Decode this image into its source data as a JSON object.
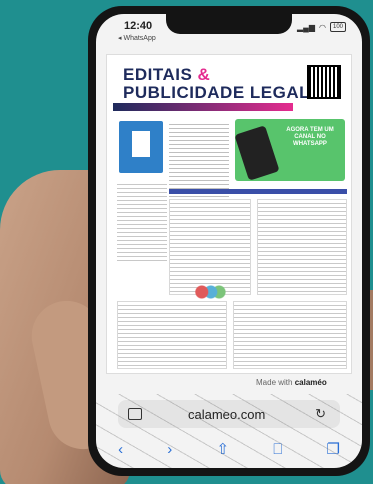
{
  "status_bar": {
    "time": "12:40",
    "back_app": "◂ WhatsApp",
    "battery": "100"
  },
  "page": {
    "title_line1": "EDITAIS",
    "title_amp": "&",
    "title_line2": "PUBLICIDADE LEGAL",
    "promo": "AGORA TEM UM CANAL NO WHATSAPP"
  },
  "watermark": {
    "prefix": "Made with",
    "brand": "calaméo"
  },
  "browser": {
    "url": "calameo.com"
  },
  "icons": [
    "reader-icon",
    "reload-icon",
    "back-icon",
    "forward-icon",
    "share-icon",
    "bookmarks-icon",
    "tabs-icon"
  ]
}
